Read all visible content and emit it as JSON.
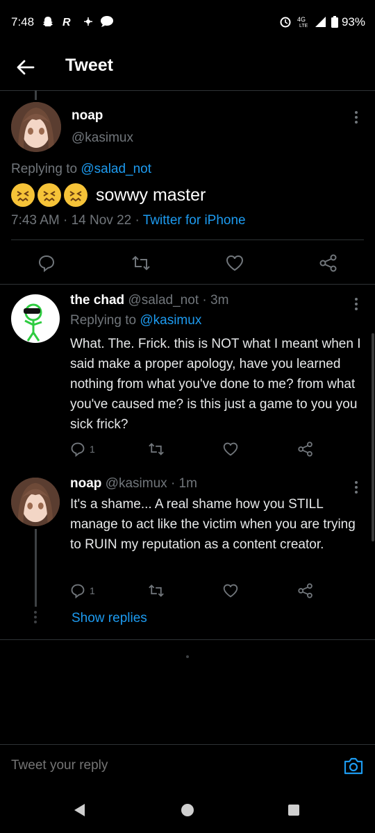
{
  "status": {
    "time": "7:48",
    "battery": "93%"
  },
  "header": {
    "title": "Tweet"
  },
  "main_tweet": {
    "name": "noap",
    "handle": "@kasimux",
    "replying_prefix": "Replying to",
    "replying_to": "@salad_not",
    "text": "sowwy master",
    "time": "7:43 AM",
    "date": "14 Nov 22",
    "source": "Twitter for iPhone"
  },
  "replies": [
    {
      "name": "the chad",
      "handle": "@salad_not",
      "ago": "3m",
      "replying_prefix": "Replying to",
      "replying_to": "@kasimux",
      "text": "What. The. Frick. this is NOT what I meant when I said make a proper apology, have you learned nothing from what you've done to me? from what you've caused me? is this just a game to you you sick frick?",
      "reply_count": "1"
    },
    {
      "name": "noap",
      "handle": "@kasimux",
      "ago": "1m",
      "text": "It's a shame... A real shame how you STILL manage to act like the victim when you are trying to RUIN my reputation as a content creator.",
      "reply_count": "1"
    }
  ],
  "show_replies": "Show replies",
  "reply_bar": {
    "placeholder": "Tweet your reply"
  },
  "colors": {
    "accent": "#1d9bf0",
    "muted": "#71767b",
    "bg": "#000000",
    "border": "#2f3336"
  }
}
